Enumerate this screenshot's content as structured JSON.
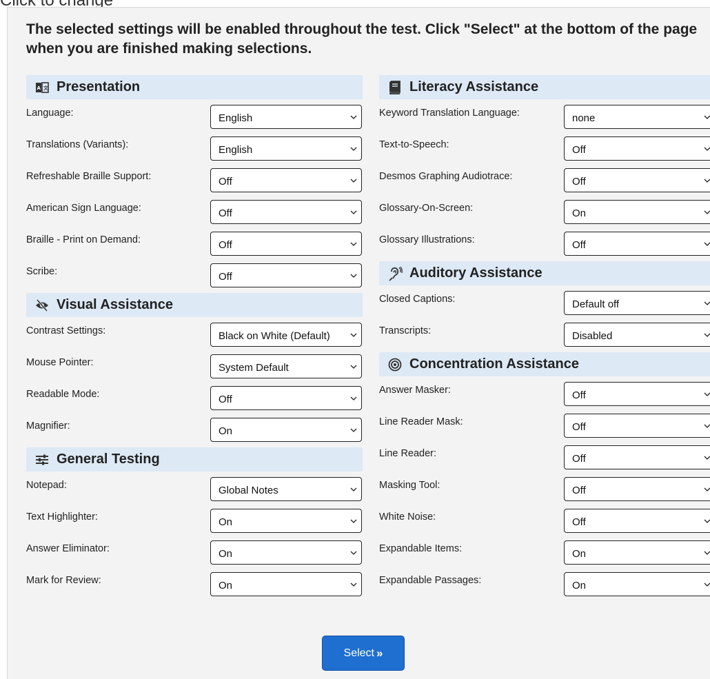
{
  "page": {
    "top_partial_text": "Click to change",
    "instructions": "The selected settings will be enabled throughout the test. Click \"Select\" at the bottom of the page when you are finished making selections."
  },
  "left_sections": [
    {
      "title": "Presentation",
      "icon": "translate-book-icon",
      "rows": [
        {
          "label": "Language:",
          "value": "English"
        },
        {
          "label": "Translations (Variants):",
          "value": "English"
        },
        {
          "label": "Refreshable Braille Support:",
          "value": "Off"
        },
        {
          "label": "American Sign Language:",
          "value": "Off"
        },
        {
          "label": "Braille - Print on Demand:",
          "value": "Off"
        },
        {
          "label": "Scribe:",
          "value": "Off"
        }
      ]
    },
    {
      "title": "Visual Assistance",
      "icon": "eye-slash-icon",
      "rows": [
        {
          "label": "Contrast Settings:",
          "value": "Black on White (Default)"
        },
        {
          "label": "Mouse Pointer:",
          "value": "System Default"
        },
        {
          "label": "Readable Mode:",
          "value": "Off"
        },
        {
          "label": "Magnifier:",
          "value": "On"
        }
      ]
    },
    {
      "title": "General Testing",
      "icon": "sliders-icon",
      "rows": [
        {
          "label": "Notepad:",
          "value": "Global Notes"
        },
        {
          "label": "Text Highlighter:",
          "value": "On"
        },
        {
          "label": "Answer Eliminator:",
          "value": "On"
        },
        {
          "label": "Mark for Review:",
          "value": "On"
        }
      ]
    }
  ],
  "right_sections": [
    {
      "title": "Literacy Assistance",
      "icon": "book-icon",
      "rows": [
        {
          "label": "Keyword Translation Language:",
          "value": "none"
        },
        {
          "label": "Text-to-Speech:",
          "value": "Off"
        },
        {
          "label": "Desmos Graphing Audiotrace:",
          "value": "Off"
        },
        {
          "label": "Glossary-On-Screen:",
          "value": "On"
        },
        {
          "label": "Glossary Illustrations:",
          "value": "Off"
        }
      ]
    },
    {
      "title": "Auditory Assistance",
      "icon": "hearing-ear-icon",
      "rows": [
        {
          "label": "Closed Captions:",
          "value": "Default off"
        },
        {
          "label": "Transcripts:",
          "value": "Disabled"
        }
      ]
    },
    {
      "title": "Concentration Assistance",
      "icon": "target-icon",
      "rows": [
        {
          "label": "Answer Masker:",
          "value": "Off"
        },
        {
          "label": "Line Reader Mask:",
          "value": "Off"
        },
        {
          "label": "Line Reader:",
          "value": "Off"
        },
        {
          "label": "Masking Tool:",
          "value": "Off"
        },
        {
          "label": "White Noise:",
          "value": "Off"
        },
        {
          "label": "Expandable Items:",
          "value": "On"
        },
        {
          "label": "Expandable Passages:",
          "value": "On"
        }
      ]
    }
  ],
  "footer": {
    "select_label": "Select",
    "select_chevrons": "»"
  },
  "colors": {
    "header_bg": "#dde9f5",
    "button_bg": "#1f6fd0",
    "panel_bg": "#f3f3f3"
  }
}
